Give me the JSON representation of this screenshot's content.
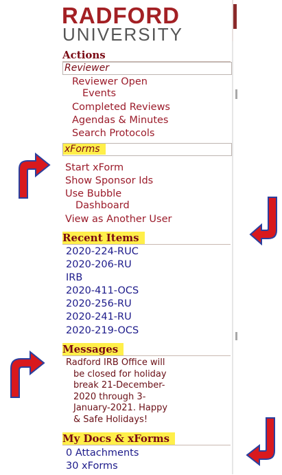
{
  "logo": {
    "line1": "RADFORD",
    "line2": "UNIVERSITY"
  },
  "actions": {
    "title": "Actions",
    "reviewer_box": "Reviewer",
    "reviewer_items": [
      "Reviewer Open",
      "Events",
      "Completed Reviews",
      "Agendas & Minutes",
      "Search Protocols"
    ],
    "xforms_box": "xForms",
    "xforms_items": [
      "Start xForm",
      "Show Sponsor Ids",
      "Use Bubble",
      "Dashboard",
      "View as Another User"
    ]
  },
  "recent": {
    "title": "Recent Items",
    "items": [
      "2020-224-RUC",
      "2020-206-RU",
      "IRB",
      "2020-411-OCS",
      "2020-256-RU",
      "2020-241-RU",
      "2020-219-OCS"
    ]
  },
  "messages": {
    "title": "Messages",
    "lines": [
      "Radford IRB Office will",
      "be closed for holiday",
      "break 21-December-",
      "2020 through 3-",
      "January-2021. Happy",
      "& Safe Holidays!"
    ]
  },
  "docs": {
    "title": "My Docs & xForms",
    "items": [
      "0 Attachments",
      "30 xForms"
    ]
  },
  "colors": {
    "arrow": "#d8191e",
    "arrow_outline": "#2a3f9e",
    "highlight": "#ffef4a",
    "link": "#9b1b2a",
    "recent": "#1c1a8a"
  }
}
